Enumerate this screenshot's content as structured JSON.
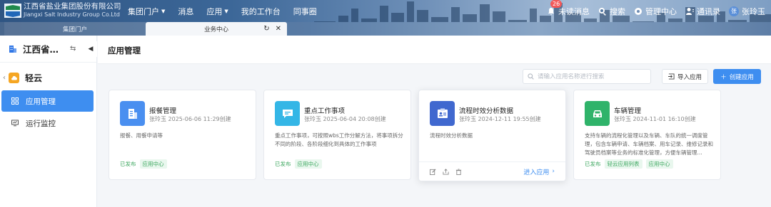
{
  "header": {
    "logo_cn": "江西省盐业集团股份有限公司",
    "logo_en": "Jiangxi Salt Industry Group Co.Ltd",
    "nav": [
      {
        "label": "集团门户",
        "has_caret": true
      },
      {
        "label": "消息",
        "has_caret": false
      },
      {
        "label": "应用",
        "has_caret": true
      },
      {
        "label": "我的工作台",
        "has_caret": false
      },
      {
        "label": "同事圈",
        "has_caret": false
      }
    ],
    "unread_label": "未读消息",
    "unread_count": "26",
    "search_label": "搜索",
    "admin_label": "管理中心",
    "contacts_label": "通讯录",
    "user_name": "张玲玉",
    "user_avatar": "张"
  },
  "tabs": [
    {
      "label": "集团门户",
      "active": false
    },
    {
      "label": "业务中心",
      "active": true
    }
  ],
  "sidebar": {
    "org_name": "江西省盐业集团股份有限公司",
    "app_name": "轻云",
    "menu": [
      {
        "label": "应用管理",
        "icon": "grid-icon",
        "active": true
      },
      {
        "label": "运行监控",
        "icon": "monitor-icon",
        "active": false
      }
    ]
  },
  "main": {
    "title": "应用管理",
    "search_placeholder": "请输入应用名称进行搜索",
    "import_label": "导入应用",
    "create_label": "创建应用",
    "cards": [
      {
        "title": "报餐管理",
        "meta": "张玲玉 2025-06-06 11:29创建",
        "desc": "报餐、用餐申请等",
        "status": "已发布",
        "tags": [
          "应用中心"
        ],
        "icon": "document-icon",
        "color": "#4a8ff0"
      },
      {
        "title": "重点工作事项",
        "meta": "张玲玉 2025-06-04 20:08创建",
        "desc": "重点工作事项，可按照wbs工作分解方法，将事项拆分不同的阶段、各阶段细化到具体的工作事项",
        "status": "已发布",
        "tags": [
          "应用中心"
        ],
        "icon": "chat-icon",
        "color": "#34b6e6"
      },
      {
        "title": "流程时效分析数据",
        "meta": "张玲玉 2024-12-11 19:55创建",
        "desc": "流程时效分析数据",
        "status": "",
        "tags": [],
        "icon": "id-card-icon",
        "color": "#4068cf",
        "enter_label": "进入应用"
      },
      {
        "title": "车辆管理",
        "meta": "张玲玉 2024-11-01 16:10创建",
        "desc": "支持车辆的流程化管理以及车辆、车队的统一调度管理，包含车辆申请、车辆档案、用车记录、维修记录和驾驶员档案等业务的标准化管理，方便车辆管理...",
        "status": "已发布",
        "tags": [
          "轻云应用列表",
          "应用中心"
        ],
        "icon": "car-icon",
        "color": "#2fb36a"
      }
    ]
  },
  "colors": {
    "accent": "#3e8ef0",
    "published": "#3fa861",
    "badge": "#f25a5a"
  }
}
